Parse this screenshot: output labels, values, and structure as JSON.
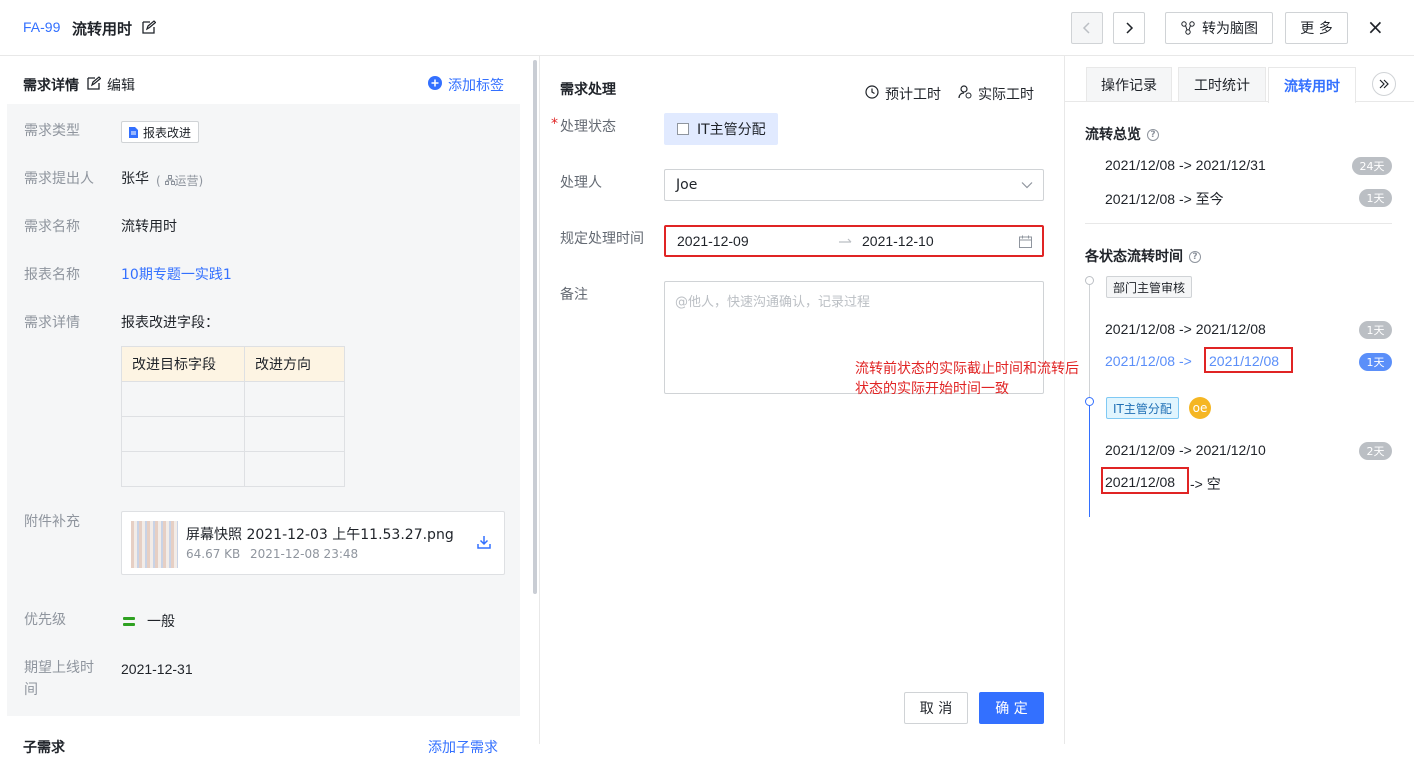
{
  "header": {
    "id": "FA-99",
    "title": "流转用时",
    "mindmap_label": "转为脑图",
    "more_label": "更 多",
    "close": "×"
  },
  "left": {
    "section_title": "需求详情",
    "edit_label": "编辑",
    "add_tag_label": "添加标签",
    "fields": {
      "type_label": "需求类型",
      "type_value": "报表改进",
      "submitter_label": "需求提出人",
      "submitter_value": "张华",
      "submitter_dept": "运营",
      "name_label": "需求名称",
      "name_value": "流转用时",
      "report_label": "报表名称",
      "report_value": "10期专题一实践1",
      "detail_label": "需求详情",
      "detail_value": "报表改进字段：",
      "table_headers": [
        "改进目标字段",
        "改进方向"
      ],
      "attach_label": "附件补充",
      "attach_name": "屏幕快照 2021-12-03 上午11.53.27.png",
      "attach_size": "64.67 KB",
      "attach_time": "2021-12-08 23:48",
      "priority_label": "优先级",
      "priority_value": "一般",
      "launch_label": "期望上线时间",
      "launch_value": "2021-12-31"
    },
    "sub_section_title": "子需求",
    "add_sub_label": "添加子需求"
  },
  "middle": {
    "section_title": "需求处理",
    "est_hours_label": "预计工时",
    "act_hours_label": "实际工时",
    "status_label": "处理状态",
    "status_value": "IT主管分配",
    "handler_label": "处理人",
    "handler_value": "Joe",
    "deadline_label": "规定处理时间",
    "date_start": "2021-12-09",
    "date_end": "2021-12-10",
    "remark_label": "备注",
    "remark_placeholder": "@他人，快速沟通确认，记录过程",
    "annotation": "流转前状态的实际截止时间和流转后状态的实际开始时间一致",
    "cancel_label": "取 消",
    "ok_label": "确 定"
  },
  "right": {
    "tabs": [
      "操作记录",
      "工时统计",
      "流转用时"
    ],
    "overview_title": "流转总览",
    "overview_rows": [
      {
        "range": "2021/12/08 -> 2021/12/31",
        "days": "24天"
      },
      {
        "range": "2021/12/08 -> 至今",
        "days": "1天"
      }
    ],
    "status_title": "各状态流转时间",
    "stage1_tag": "部门主管审核",
    "stage1_rows": [
      {
        "start": "2021/12/08",
        "arrow": " -> ",
        "end": "2021/12/08",
        "days": "1天"
      },
      {
        "start": "2021/12/08",
        "arrow": " ->",
        "end": "2021/12/08",
        "days": "1天"
      }
    ],
    "stage2_tag": "IT主管分配",
    "stage2_avatar": "oe",
    "stage2_rows": [
      {
        "range": "2021/12/09 -> 2021/12/10",
        "days": "2天"
      },
      {
        "start": "2021/12/08",
        "rest": "-> 空"
      }
    ]
  },
  "colors": {
    "primary": "#3370ff",
    "annotation": "#e02424",
    "badge_gray": "#bbbfc4"
  }
}
